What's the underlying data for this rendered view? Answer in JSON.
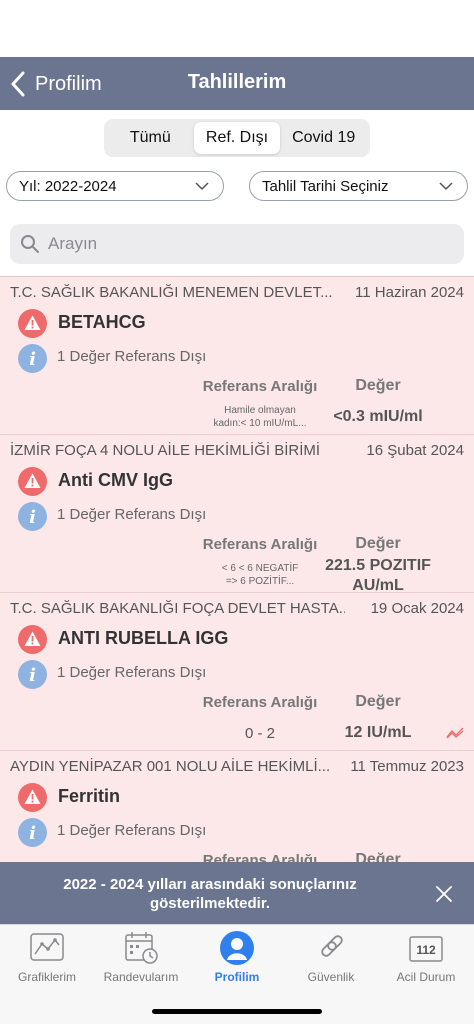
{
  "nav": {
    "back_label": "Profilim",
    "title": "Tahlillerim"
  },
  "segments": [
    {
      "label": "Tümü",
      "active": false
    },
    {
      "label": "Ref. Dışı",
      "active": true
    },
    {
      "label": "Covid 19",
      "active": false
    }
  ],
  "filters": {
    "year": "Yıl: 2022-2024",
    "date": "Tahlil Tarihi Seçiniz"
  },
  "search": {
    "placeholder": "Arayın"
  },
  "columns": {
    "reference": "Referans Aralığı",
    "value": "Değer"
  },
  "results": [
    {
      "institution": "T.C. SAĞLIK BAKANLIĞI MENEMEN DEVLET...",
      "date": "11 Haziran 2024",
      "test": "BETAHCG",
      "info": "1 Değer Referans Dışı",
      "reference_lines": [
        "Hamile olmayan",
        "kadın:< 10 mIU/mL..."
      ],
      "value_lines": [
        "<0.3 mIU/ml"
      ]
    },
    {
      "institution": "İZMİR FOÇA 4 NOLU AİLE HEKİMLİĞİ BİRİMİ",
      "date": "16 Şubat 2024",
      "test": "Anti CMV IgG",
      "info": "1 Değer Referans Dışı",
      "reference_lines": [
        "< 6 < 6 NEGATİF",
        "=> 6 POZİTİF..."
      ],
      "value_lines": [
        "221.5 POZITIF",
        "AU/mL"
      ]
    },
    {
      "institution": "T.C. SAĞLIK BAKANLIĞI FOÇA DEVLET HASTA...",
      "date": "19 Ocak 2024",
      "test": "ANTI RUBELLA IGG",
      "info": "1 Değer Referans Dışı",
      "reference": "0 - 2",
      "value_lines": [
        "12 IU/mL"
      ],
      "trend_icon": "trend-chart-icon"
    },
    {
      "institution": "AYDIN YENİPAZAR 001 NOLU AİLE HEKİMLİ...",
      "date": "11 Temmuz 2023",
      "test": "Ferritin",
      "info": "1 Değer Referans Dışı"
    }
  ],
  "banner": {
    "text": "2022 - 2024 yılları arasındaki sonuçlarınız gösterilmektedir."
  },
  "tabs": [
    {
      "label": "Grafiklerim",
      "icon": "chart-icon"
    },
    {
      "label": "Randevularım",
      "icon": "calendar-icon"
    },
    {
      "label": "Profilim",
      "icon": "profile-icon",
      "active": true
    },
    {
      "label": "Güvenlik",
      "icon": "link-icon"
    },
    {
      "label": "Acil Durum",
      "icon": "emergency-112-icon",
      "badge": "112"
    }
  ],
  "colors": {
    "nav_bg": "#6b7590",
    "card_bg": "#fce8e8",
    "warning_red": "#ef6b6b",
    "info_blue": "#8fb3e0",
    "active_tab": "#2f80ed"
  }
}
